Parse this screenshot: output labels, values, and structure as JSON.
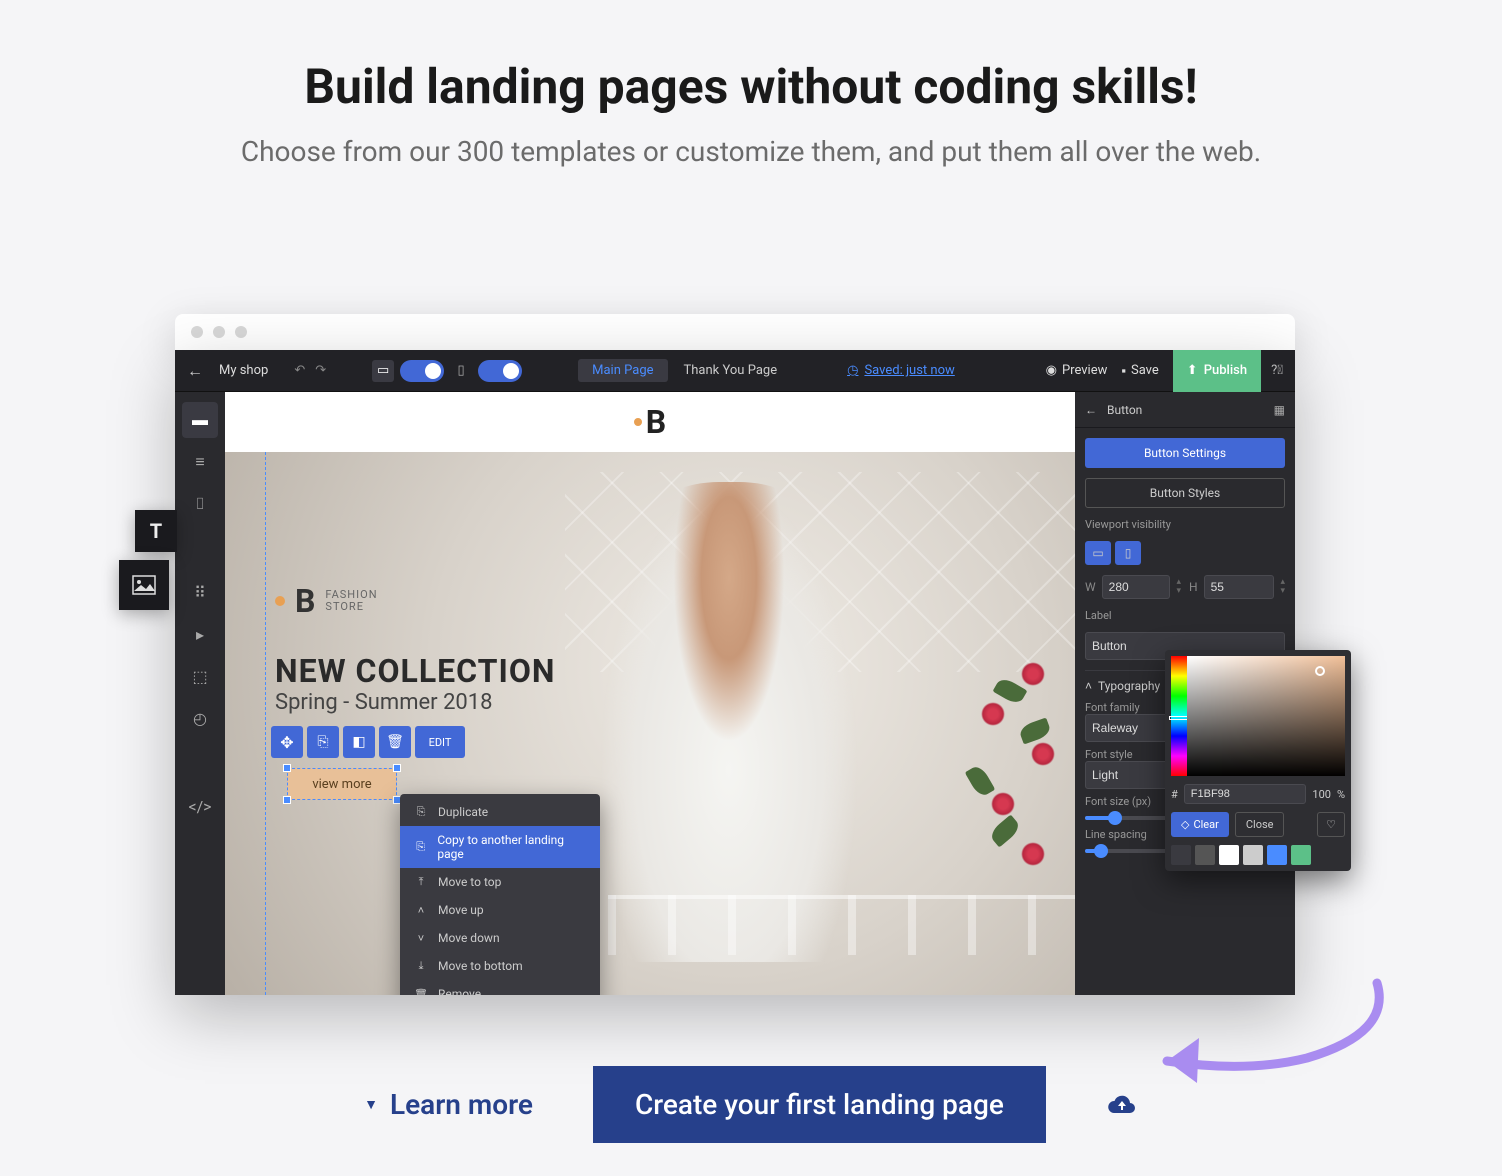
{
  "hero": {
    "title": "Build landing pages without coding skills!",
    "subtitle": "Choose from our 300 templates or customize them, and put them all over the web."
  },
  "editor": {
    "topbar": {
      "shop_label": "My shop",
      "tabs": {
        "main": "Main Page",
        "thanks": "Thank You Page"
      },
      "saved_label": "Saved: just now",
      "preview": "Preview",
      "save": "Save",
      "publish": "Publish"
    },
    "canvas": {
      "logo_text": "B",
      "brand_b": "B",
      "brand_label1": "FASHION",
      "brand_label2": "STORE",
      "heading": "NEW COLLECTION",
      "subheading": "Spring - Summer 2018",
      "edit_label": "EDIT",
      "viewmore": "view more"
    },
    "context_menu": {
      "duplicate": "Duplicate",
      "copy": "Copy to another landing page",
      "move_top": "Move to top",
      "move_up": "Move up",
      "move_down": "Move down",
      "move_bottom": "Move to bottom",
      "remove": "Remove"
    },
    "rightpanel": {
      "title": "Button",
      "tab_settings": "Button Settings",
      "tab_styles": "Button Styles",
      "viewport_label": "Viewport visibility",
      "w_label": "W",
      "w_value": "280",
      "h_label": "H",
      "h_value": "55",
      "label_label": "Label",
      "label_value": "Button",
      "typography": "Typography",
      "fontfamily_label": "Font family",
      "fontfamily_value": "Raleway",
      "fontstyle_label": "Font style",
      "fontstyle_value": "Light",
      "fontsize_label": "Font size (px)",
      "linespacing_label": "Line spacing"
    },
    "colorpicker": {
      "hash": "#",
      "hex": "F1BF98",
      "pct": "100",
      "pct_unit": "%",
      "clear": "Clear",
      "close": "Close",
      "swatches": [
        "#3a3a40",
        "#555",
        "#fff",
        "#ccc",
        "#4a8cff",
        "#5cc088"
      ]
    }
  },
  "cta": {
    "learn_more": "Learn more",
    "button": "Create your first landing page"
  }
}
